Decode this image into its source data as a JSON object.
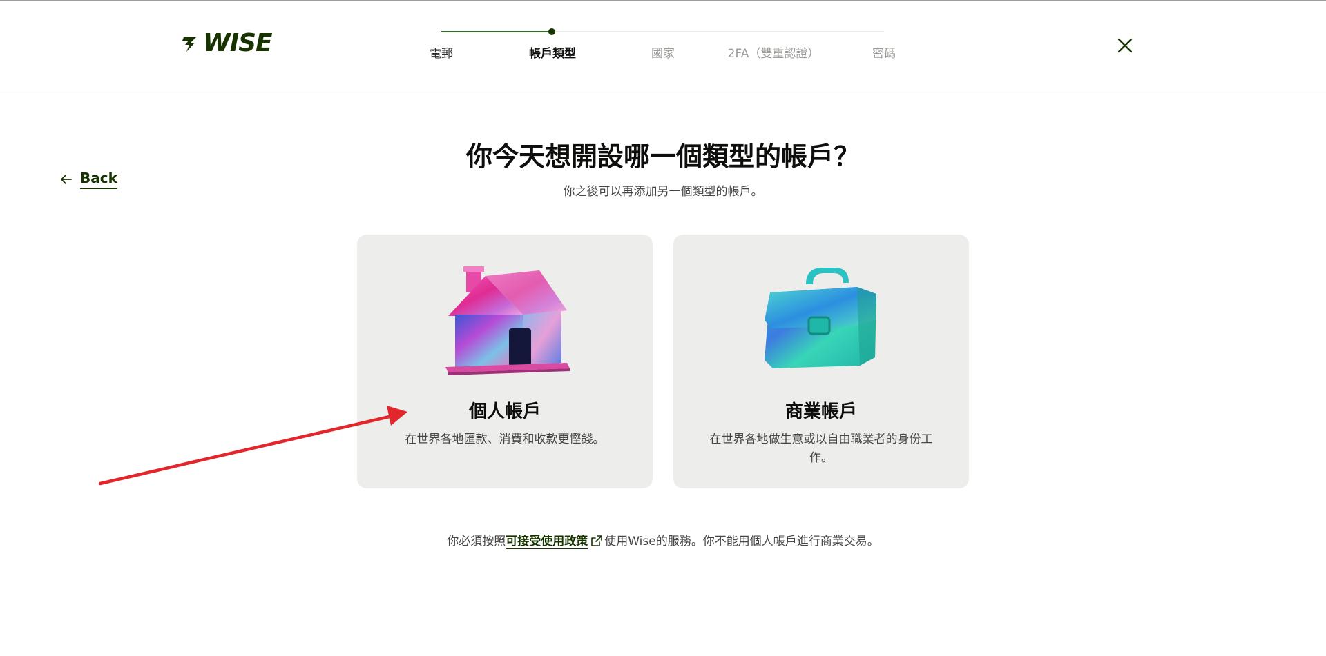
{
  "brand": {
    "name": "WISE"
  },
  "stepper": {
    "steps": [
      {
        "label": "電郵",
        "state": "done"
      },
      {
        "label": "帳戶類型",
        "state": "active"
      },
      {
        "label": "國家",
        "state": "todo"
      },
      {
        "label": "2FA（雙重認證）",
        "state": "todo"
      },
      {
        "label": "密碼",
        "state": "todo"
      }
    ],
    "progress": 0.25
  },
  "nav": {
    "back_label": "Back"
  },
  "main": {
    "title": "你今天想開設哪一個類型的帳戶？",
    "subtitle": "你之後可以再添加另一個類型的帳戶。"
  },
  "cards": [
    {
      "title": "個人帳戶",
      "description": "在世界各地匯款、消費和收款更慳錢。",
      "illustration": "house-illustration"
    },
    {
      "title": "商業帳戶",
      "description": "在世界各地做生意或以自由職業者的身份工作。",
      "illustration": "briefcase-illustration"
    }
  ],
  "footer": {
    "prefix": "你必須按照",
    "link_label": "可接受使用政策",
    "suffix": "使用Wise的服務。你不能用個人帳戶進行商業交易。"
  },
  "colors": {
    "brand_green": "#163300",
    "progress_green": "#2f6f1c",
    "card_bg": "#edeeeb",
    "annotation_red": "#e3262c"
  }
}
